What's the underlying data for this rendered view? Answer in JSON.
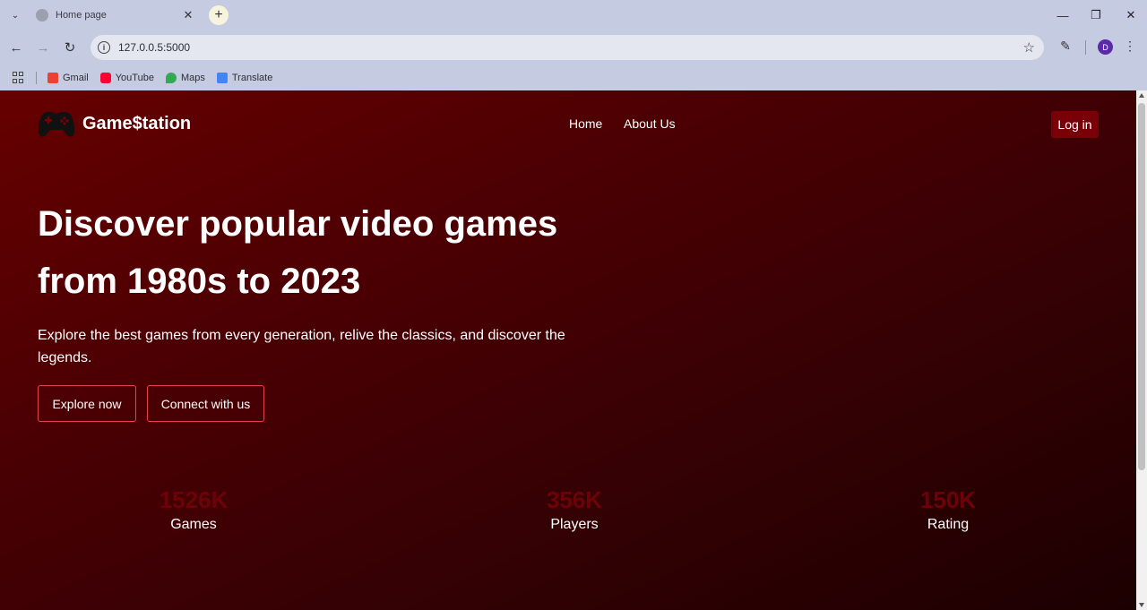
{
  "browser": {
    "tab_title": "Home page",
    "url": "127.0.0.5:5000",
    "profile_initial": "D",
    "bookmarks": [
      {
        "label": "Gmail",
        "color": "#ea4335"
      },
      {
        "label": "YouTube",
        "color": "#ff0033"
      },
      {
        "label": "Maps",
        "color": "#34a853"
      },
      {
        "label": "Translate",
        "color": "#4285f4"
      }
    ]
  },
  "site": {
    "brand": "Game$tation",
    "nav": {
      "home": "Home",
      "about": "About Us",
      "login": "Log in"
    },
    "hero": {
      "title": "Discover popular video games from 1980s to 2023",
      "subtitle": "Explore the best games from every generation, relive the classics, and discover the legends.",
      "explore_btn": "Explore now",
      "connect_btn": "Connect with us"
    },
    "stats": [
      {
        "value": "1526K",
        "label": "Games"
      },
      {
        "value": "356K",
        "label": "Players"
      },
      {
        "value": "150K",
        "label": "Rating"
      }
    ],
    "colors": {
      "accent": "#7a0008",
      "button_border": "#e0454f",
      "stat_number": "#6e0008"
    }
  }
}
